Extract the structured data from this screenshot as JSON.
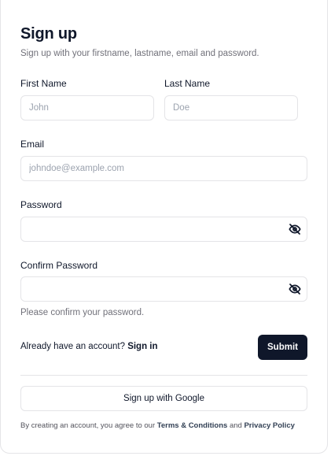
{
  "form": {
    "title": "Sign up",
    "subtitle": "Sign up with your firstname, lastname, email and password."
  },
  "fields": {
    "first_name": {
      "label": "First Name",
      "placeholder": "John",
      "value": ""
    },
    "last_name": {
      "label": "Last Name",
      "placeholder": "Doe",
      "value": ""
    },
    "email": {
      "label": "Email",
      "placeholder": "johndoe@example.com",
      "value": ""
    },
    "password": {
      "label": "Password",
      "value": "",
      "toggle_icon": "eye-off-icon"
    },
    "confirm_password": {
      "label": "Confirm Password",
      "value": "",
      "toggle_icon": "eye-off-icon",
      "hint": "Please confirm your password."
    }
  },
  "signin": {
    "prompt": "Already have an account?",
    "link": "Sign in"
  },
  "actions": {
    "submit_label": "Submit",
    "google_label": "Sign up with Google"
  },
  "terms": {
    "prefix": "By creating an account, you agree to our",
    "terms_link": "Terms & Conditions",
    "conjunction": "and",
    "privacy_link": "Privacy Policy"
  },
  "colors": {
    "primary": "#0f172a",
    "muted": "#71717a",
    "border": "#e4e4e7"
  }
}
